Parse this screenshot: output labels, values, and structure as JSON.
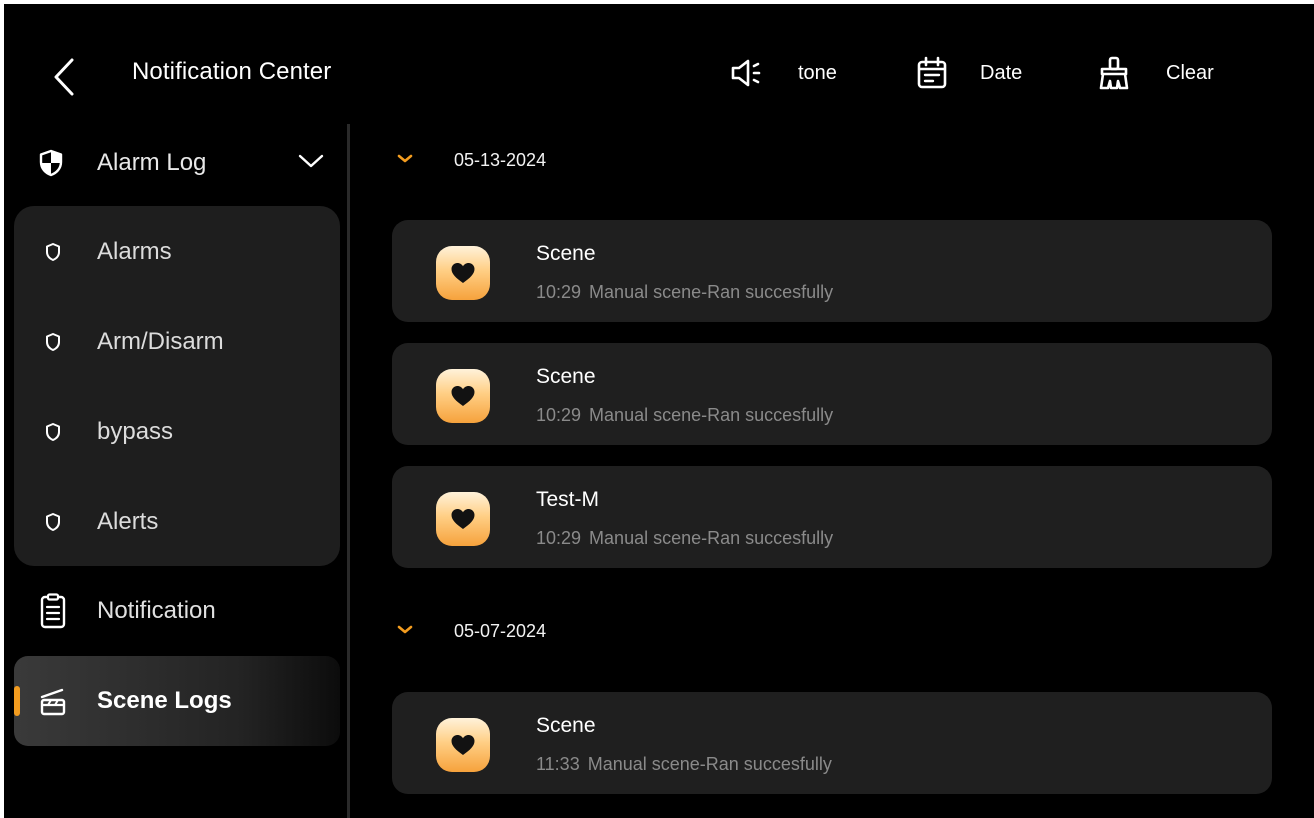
{
  "header": {
    "title": "Notification Center",
    "back_icon": "chevron-left-icon",
    "toolbar": [
      {
        "label": "tone",
        "icon": "speaker-icon"
      },
      {
        "label": "Date",
        "icon": "calendar-icon"
      },
      {
        "label": "Clear",
        "icon": "broom-icon"
      }
    ]
  },
  "sidebar": {
    "group": {
      "label": "Alarm Log",
      "icon": "shield-icon",
      "expanded": true,
      "items": [
        {
          "label": "Alarms",
          "icon": "shield-outline-icon"
        },
        {
          "label": "Arm/Disarm",
          "icon": "shield-outline-icon"
        },
        {
          "label": "bypass",
          "icon": "shield-outline-icon"
        },
        {
          "label": "Alerts",
          "icon": "shield-outline-icon"
        }
      ]
    },
    "items": [
      {
        "label": "Notification",
        "icon": "clipboard-icon",
        "active": false
      },
      {
        "label": "Scene Logs",
        "icon": "clapperboard-icon",
        "active": true
      }
    ]
  },
  "log_groups": [
    {
      "date": "05-13-2024",
      "entries": [
        {
          "title": "Scene",
          "time": "10:29",
          "message": "Manual scene-Ran succesfully"
        },
        {
          "title": "Scene",
          "time": "10:29",
          "message": "Manual scene-Ran succesfully"
        },
        {
          "title": "Test-M",
          "time": "10:29",
          "message": "Manual scene-Ran succesfully"
        }
      ]
    },
    {
      "date": "05-07-2024",
      "entries": [
        {
          "title": "Scene",
          "time": "11:33",
          "message": "Manual scene-Ran succesfully"
        }
      ]
    }
  ],
  "colors": {
    "background": "#000000",
    "card": "#1f1f1f",
    "accent": "#f39c1f",
    "muted_text": "#8a8a8a"
  }
}
